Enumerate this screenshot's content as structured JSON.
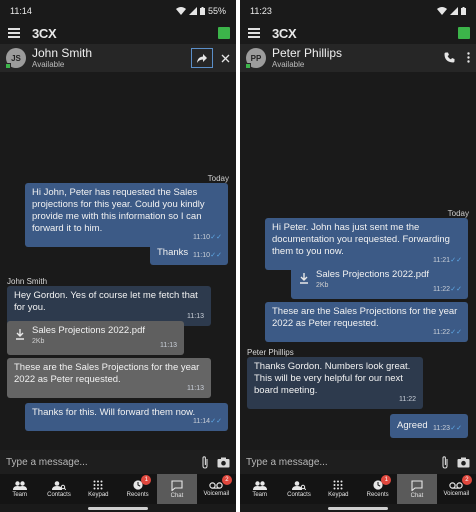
{
  "left": {
    "status_time": "11:14",
    "battery": "55%",
    "app_logo": "3CX",
    "contact": {
      "initials": "JS",
      "name": "John Smith",
      "status": "Available"
    },
    "day_label": "Today",
    "sender_label": "John Smith",
    "messages": [
      {
        "text": "Hi John, Peter has requested the Sales projections for this year. Could you kindly provide me with this information so I can forward it to him.",
        "time": "11:10"
      },
      {
        "text": "Thanks",
        "time": "11:10"
      },
      {
        "text": "Hey Gordon. Yes of course let me fetch that for you.",
        "time": "11:13"
      },
      {
        "file_name": "Sales Projections 2022.pdf",
        "file_size": "2Kb",
        "time": "11:13"
      },
      {
        "text": "These are the Sales Projections for the year 2022 as Peter requested.",
        "time": "11:13"
      },
      {
        "text": "Thanks for this. Will forward them now.",
        "time": "11:14"
      }
    ]
  },
  "right": {
    "status_time": "11:23",
    "app_logo": "3CX",
    "contact": {
      "initials": "PP",
      "name": "Peter Phillips",
      "status": "Available"
    },
    "day_label": "Today",
    "sender_label": "Peter Phillips",
    "messages": [
      {
        "text": "Hi Peter. John has just sent me the documentation you requested. Forwarding them to you now.",
        "time": "11:21"
      },
      {
        "file_name": "Sales Projections 2022.pdf",
        "file_size": "2Kb",
        "time": "11:22"
      },
      {
        "text": "These are the Sales Projections for the year 2022 as Peter requested.",
        "time": "11:22"
      },
      {
        "text": "Thanks Gordon. Numbers look great. This will be very helpful for our next board meeting.",
        "time": "11:22"
      },
      {
        "text": "Agreed",
        "time": "11:23"
      }
    ]
  },
  "composer": {
    "placeholder": "Type a message..."
  },
  "nav": {
    "items": [
      {
        "label": "Team",
        "icon": "team-icon"
      },
      {
        "label": "Contacts",
        "icon": "contacts-icon"
      },
      {
        "label": "Keypad",
        "icon": "keypad-icon"
      },
      {
        "label": "Recents",
        "icon": "recents-icon",
        "badge": "1"
      },
      {
        "label": "Chat",
        "icon": "chat-icon"
      },
      {
        "label": "Voicemail",
        "icon": "voicemail-icon",
        "badge": "2"
      }
    ]
  },
  "colors": {
    "outgoing_bubble": "#3c5a86",
    "incoming_bubble": "#2d3a4d",
    "forwarded_bubble": "#656565",
    "presence_green": "#3cb44a",
    "badge_red": "#e0483e",
    "read_check": "#5fa9e6"
  }
}
